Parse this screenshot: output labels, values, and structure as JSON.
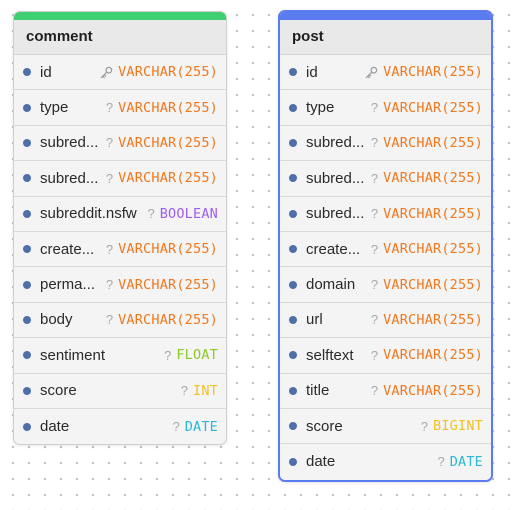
{
  "tables": [
    {
      "name": "comment",
      "accent": "#3fcf73",
      "selected": false,
      "columns": [
        {
          "name": "id",
          "type": "VARCHAR(255)",
          "marker": "key",
          "color": "#f0781e"
        },
        {
          "name": "type",
          "type": "VARCHAR(255)",
          "marker": "?",
          "color": "#f0781e"
        },
        {
          "name": "subred...",
          "type": "VARCHAR(255)",
          "marker": "?",
          "color": "#f0781e"
        },
        {
          "name": "subred...",
          "type": "VARCHAR(255)",
          "marker": "?",
          "color": "#f0781e"
        },
        {
          "name": "subreddit.nsfw",
          "type": "BOOLEAN",
          "marker": "?",
          "color": "#9a5ff0"
        },
        {
          "name": "create...",
          "type": "VARCHAR(255)",
          "marker": "?",
          "color": "#f0781e"
        },
        {
          "name": "perma...",
          "type": "VARCHAR(255)",
          "marker": "?",
          "color": "#f0781e"
        },
        {
          "name": "body",
          "type": "VARCHAR(255)",
          "marker": "?",
          "color": "#f0781e"
        },
        {
          "name": "sentiment",
          "type": "FLOAT",
          "marker": "?",
          "color": "#8ac926"
        },
        {
          "name": "score",
          "type": "INT",
          "marker": "?",
          "color": "#f2c122"
        },
        {
          "name": "date",
          "type": "DATE",
          "marker": "?",
          "color": "#2bb8d4"
        }
      ]
    },
    {
      "name": "post",
      "accent": "#5b7cf0",
      "selected": true,
      "columns": [
        {
          "name": "id",
          "type": "VARCHAR(255)",
          "marker": "key",
          "color": "#f0781e"
        },
        {
          "name": "type",
          "type": "VARCHAR(255)",
          "marker": "?",
          "color": "#f0781e"
        },
        {
          "name": "subred...",
          "type": "VARCHAR(255)",
          "marker": "?",
          "color": "#f0781e"
        },
        {
          "name": "subred...",
          "type": "VARCHAR(255)",
          "marker": "?",
          "color": "#f0781e"
        },
        {
          "name": "subred...",
          "type": "VARCHAR(255)",
          "marker": "?",
          "color": "#f0781e"
        },
        {
          "name": "create...",
          "type": "VARCHAR(255)",
          "marker": "?",
          "color": "#f0781e"
        },
        {
          "name": "domain",
          "type": "VARCHAR(255)",
          "marker": "?",
          "color": "#f0781e"
        },
        {
          "name": "url",
          "type": "VARCHAR(255)",
          "marker": "?",
          "color": "#f0781e"
        },
        {
          "name": "selftext",
          "type": "VARCHAR(255)",
          "marker": "?",
          "color": "#f0781e"
        },
        {
          "name": "title",
          "type": "VARCHAR(255)",
          "marker": "?",
          "color": "#f0781e"
        },
        {
          "name": "score",
          "type": "BIGINT",
          "marker": "?",
          "color": "#f2c122"
        },
        {
          "name": "date",
          "type": "DATE",
          "marker": "?",
          "color": "#2bb8d4"
        }
      ]
    }
  ]
}
